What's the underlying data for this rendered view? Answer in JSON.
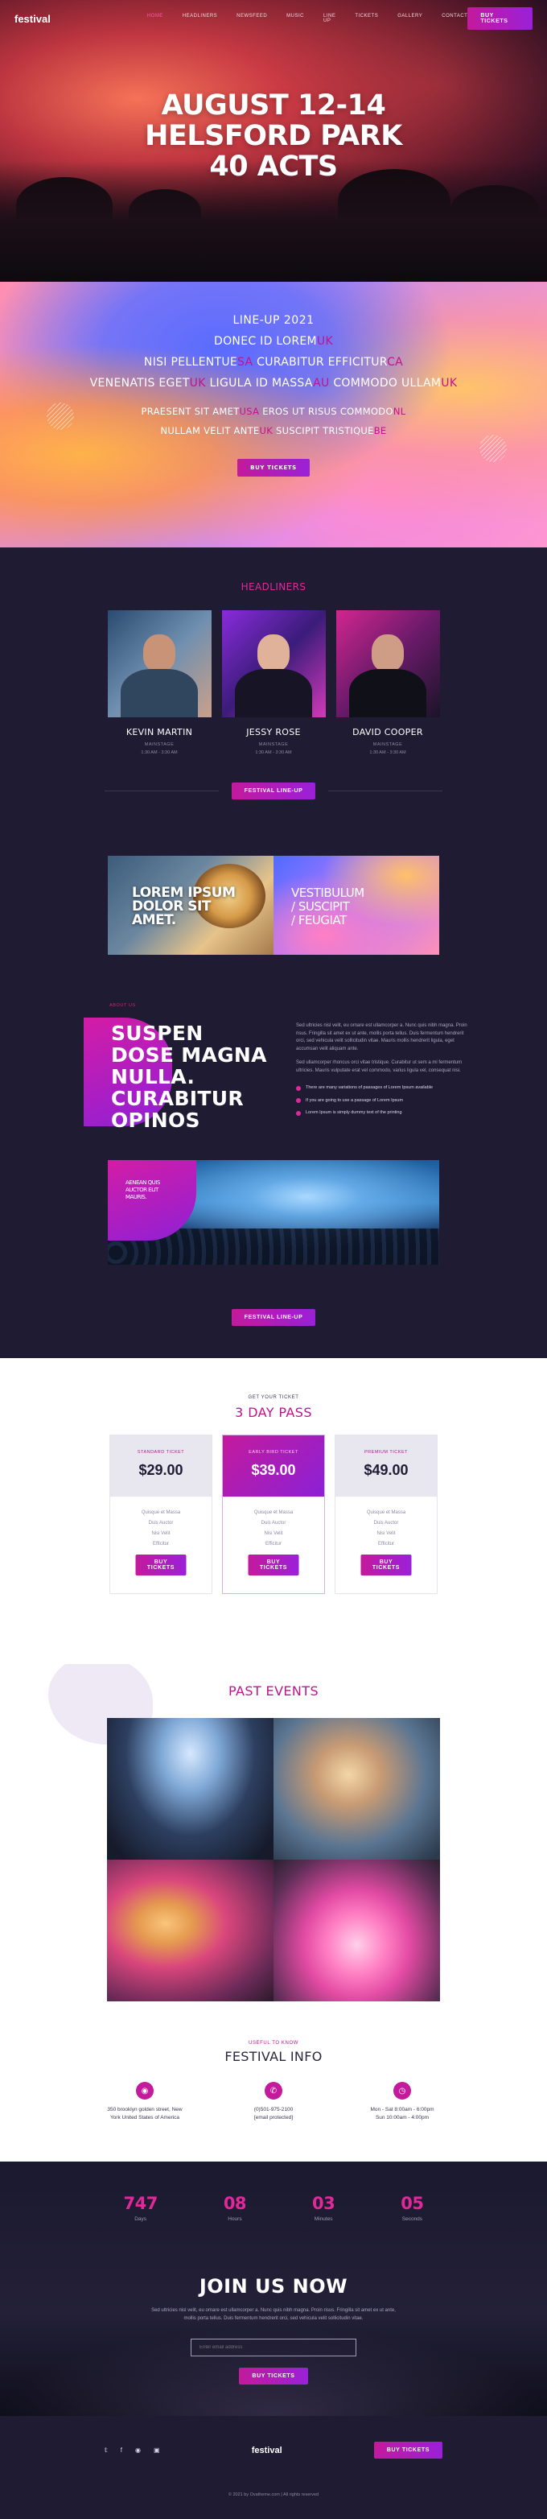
{
  "brand": {
    "logo": "festival",
    "accent": "#e1289a",
    "bg_dark": "#1e1b33"
  },
  "nav": {
    "items": [
      "HOME",
      "HEADLINERS",
      "NEWSFEED",
      "MUSIC",
      "LINE UP",
      "TICKETS",
      "GALLERY",
      "CONTACT"
    ],
    "active_index": 0,
    "cta": "BUY TICKETS"
  },
  "hero": {
    "line1": "AUGUST 12-14",
    "line2": "HELSFORD PARK",
    "line3": "40 ACTS"
  },
  "lineup": {
    "title": "LINE-UP 2021",
    "row1": {
      "a": "DONEC ID LOREM",
      "b": "UK"
    },
    "row2": {
      "a": "NISI PELLENTUE",
      "b": "SA",
      "c": " CURABITUR EFFICITUR",
      "d": "CA"
    },
    "row3": {
      "a": "VENENATIS EGET",
      "b": "UK",
      "c": " LIGULA ID MASSA",
      "d": "AU",
      "e": " COMMODO ULLAM",
      "f": "UK"
    },
    "row4": {
      "a": "PRAESENT SIT AMET",
      "b": "USA",
      "c": " EROS UT RISUS COMMODO",
      "d": "NL"
    },
    "row5": {
      "a": "NULLAM VELIT ANTE",
      "b": "UK",
      "c": " SUSCIPIT TRISTIQUE",
      "d": "BE"
    },
    "button": "BUY TICKETS"
  },
  "headliners": {
    "title": "HEADLINERS",
    "artists": [
      {
        "name": "KEVIN MARTIN",
        "genre": "MAINSTAGE",
        "time": "1:30 AM - 3:30 AM"
      },
      {
        "name": "JESSY ROSE",
        "genre": "MAINSTAGE",
        "time": "1:30 AM - 3:30 AM"
      },
      {
        "name": "DAVID COOPER",
        "genre": "MAINSTAGE",
        "time": "1:30 AM - 3:30 AM"
      }
    ],
    "button": "FESTIVAL LINE-UP"
  },
  "promo": {
    "left": "LOREM IPSUM\nDOLOR SIT\nAMET.",
    "right": "VESTIBULUM\n/ SUSCIPIT\n/ FEUGIAT"
  },
  "about": {
    "kicker": "ABOUT US",
    "heading": "SUSPEN DOSE MAGNA NULLA. CURABITUR OPINOS",
    "p1": "Sed ultricies nisl velit, eu ornare est ullamcorper a. Nunc quis nibh magna. Proin risus. Fringilla sit amet ex ut ante, mollis porta tellus. Duis fermentum hendrerit orci, sed vehicula velit sollicitudin vitae. Mauris mollis hendrerit ligula, eget accumsan velit aliquam ante.",
    "p2": "Sed ullamcorper rhoncus orci vitae tristique. Curabitur ut sem a mi fermentum ultricies. Mauris vulputate erat vel commodo, varius ligula vel, consequat nisi.",
    "bullets": [
      "There are many variations of passages of Lorem Ipsum available",
      "If you are going to use a passage of Lorem Ipsum",
      "Lorem Ipsum is simply dummy text of the printing"
    ],
    "photo_caption": "AENEAN QUIS\nAUCTOR ELIT\nMAURIS.",
    "button": "FESTIVAL LINE-UP"
  },
  "pricing": {
    "kicker": "GET YOUR TICKET",
    "title": "3 DAY PASS",
    "plans": [
      {
        "title": "STANDARD TICKET",
        "price": "$29.00",
        "features": [
          "Quisque et Massa",
          "Duis Auctor",
          "Nisi Velit",
          "Efficitur"
        ],
        "button": "BUY TICKETS"
      },
      {
        "title": "EARLY BIRD TICKET",
        "price": "$39.00",
        "features": [
          "Quisque et Massa",
          "Duis Auctor",
          "Nisi Velit",
          "Efficitur"
        ],
        "button": "BUY TICKETS"
      },
      {
        "title": "PREMIUM TICKET",
        "price": "$49.00",
        "features": [
          "Quisque et Massa",
          "Duis Auctor",
          "Nisi Velit",
          "Efficitur"
        ],
        "button": "BUY TICKETS"
      }
    ]
  },
  "past_events": {
    "title": "PAST EVENTS"
  },
  "festival_info": {
    "kicker": "USEFUL TO KNOW",
    "title": "FESTIVAL INFO",
    "cols": [
      {
        "icon": "location-pin-icon",
        "line1": "350 brooklyn golden street, New",
        "line2": "York United States of America"
      },
      {
        "icon": "phone-icon",
        "line1": "(0)501-975-2100",
        "line2": "[email protected]"
      },
      {
        "icon": "clock-icon",
        "line1": "Mon - Sat 8:00am - 6:00pm",
        "line2": "Sun 10:00am - 4:00pm"
      }
    ]
  },
  "countdown": {
    "items": [
      {
        "value": "747",
        "label": "Days"
      },
      {
        "value": "08",
        "label": "Hours"
      },
      {
        "value": "03",
        "label": "Minutes"
      },
      {
        "value": "05",
        "label": "Seconds"
      }
    ],
    "title": "JOIN US NOW",
    "desc": "Sed ultricies nisl velit, eu ornare est ullamcorper a. Nunc quis nibh magna. Proin risus. Fringilla sit amet ex ut ante, mollis porta tellus. Duis fermentum hendrerit orci, sed vehicula velit sollicitudin vitae.",
    "email_placeholder": "Enter email address",
    "button": "BUY TICKETS"
  },
  "footer": {
    "social": [
      "twitter-icon",
      "facebook-icon",
      "dribbble-icon",
      "instagram-icon"
    ],
    "logo": "festival",
    "button": "BUY TICKETS",
    "copyright": "© 2021 by Ovatheme.com  |  All rights reserved"
  }
}
